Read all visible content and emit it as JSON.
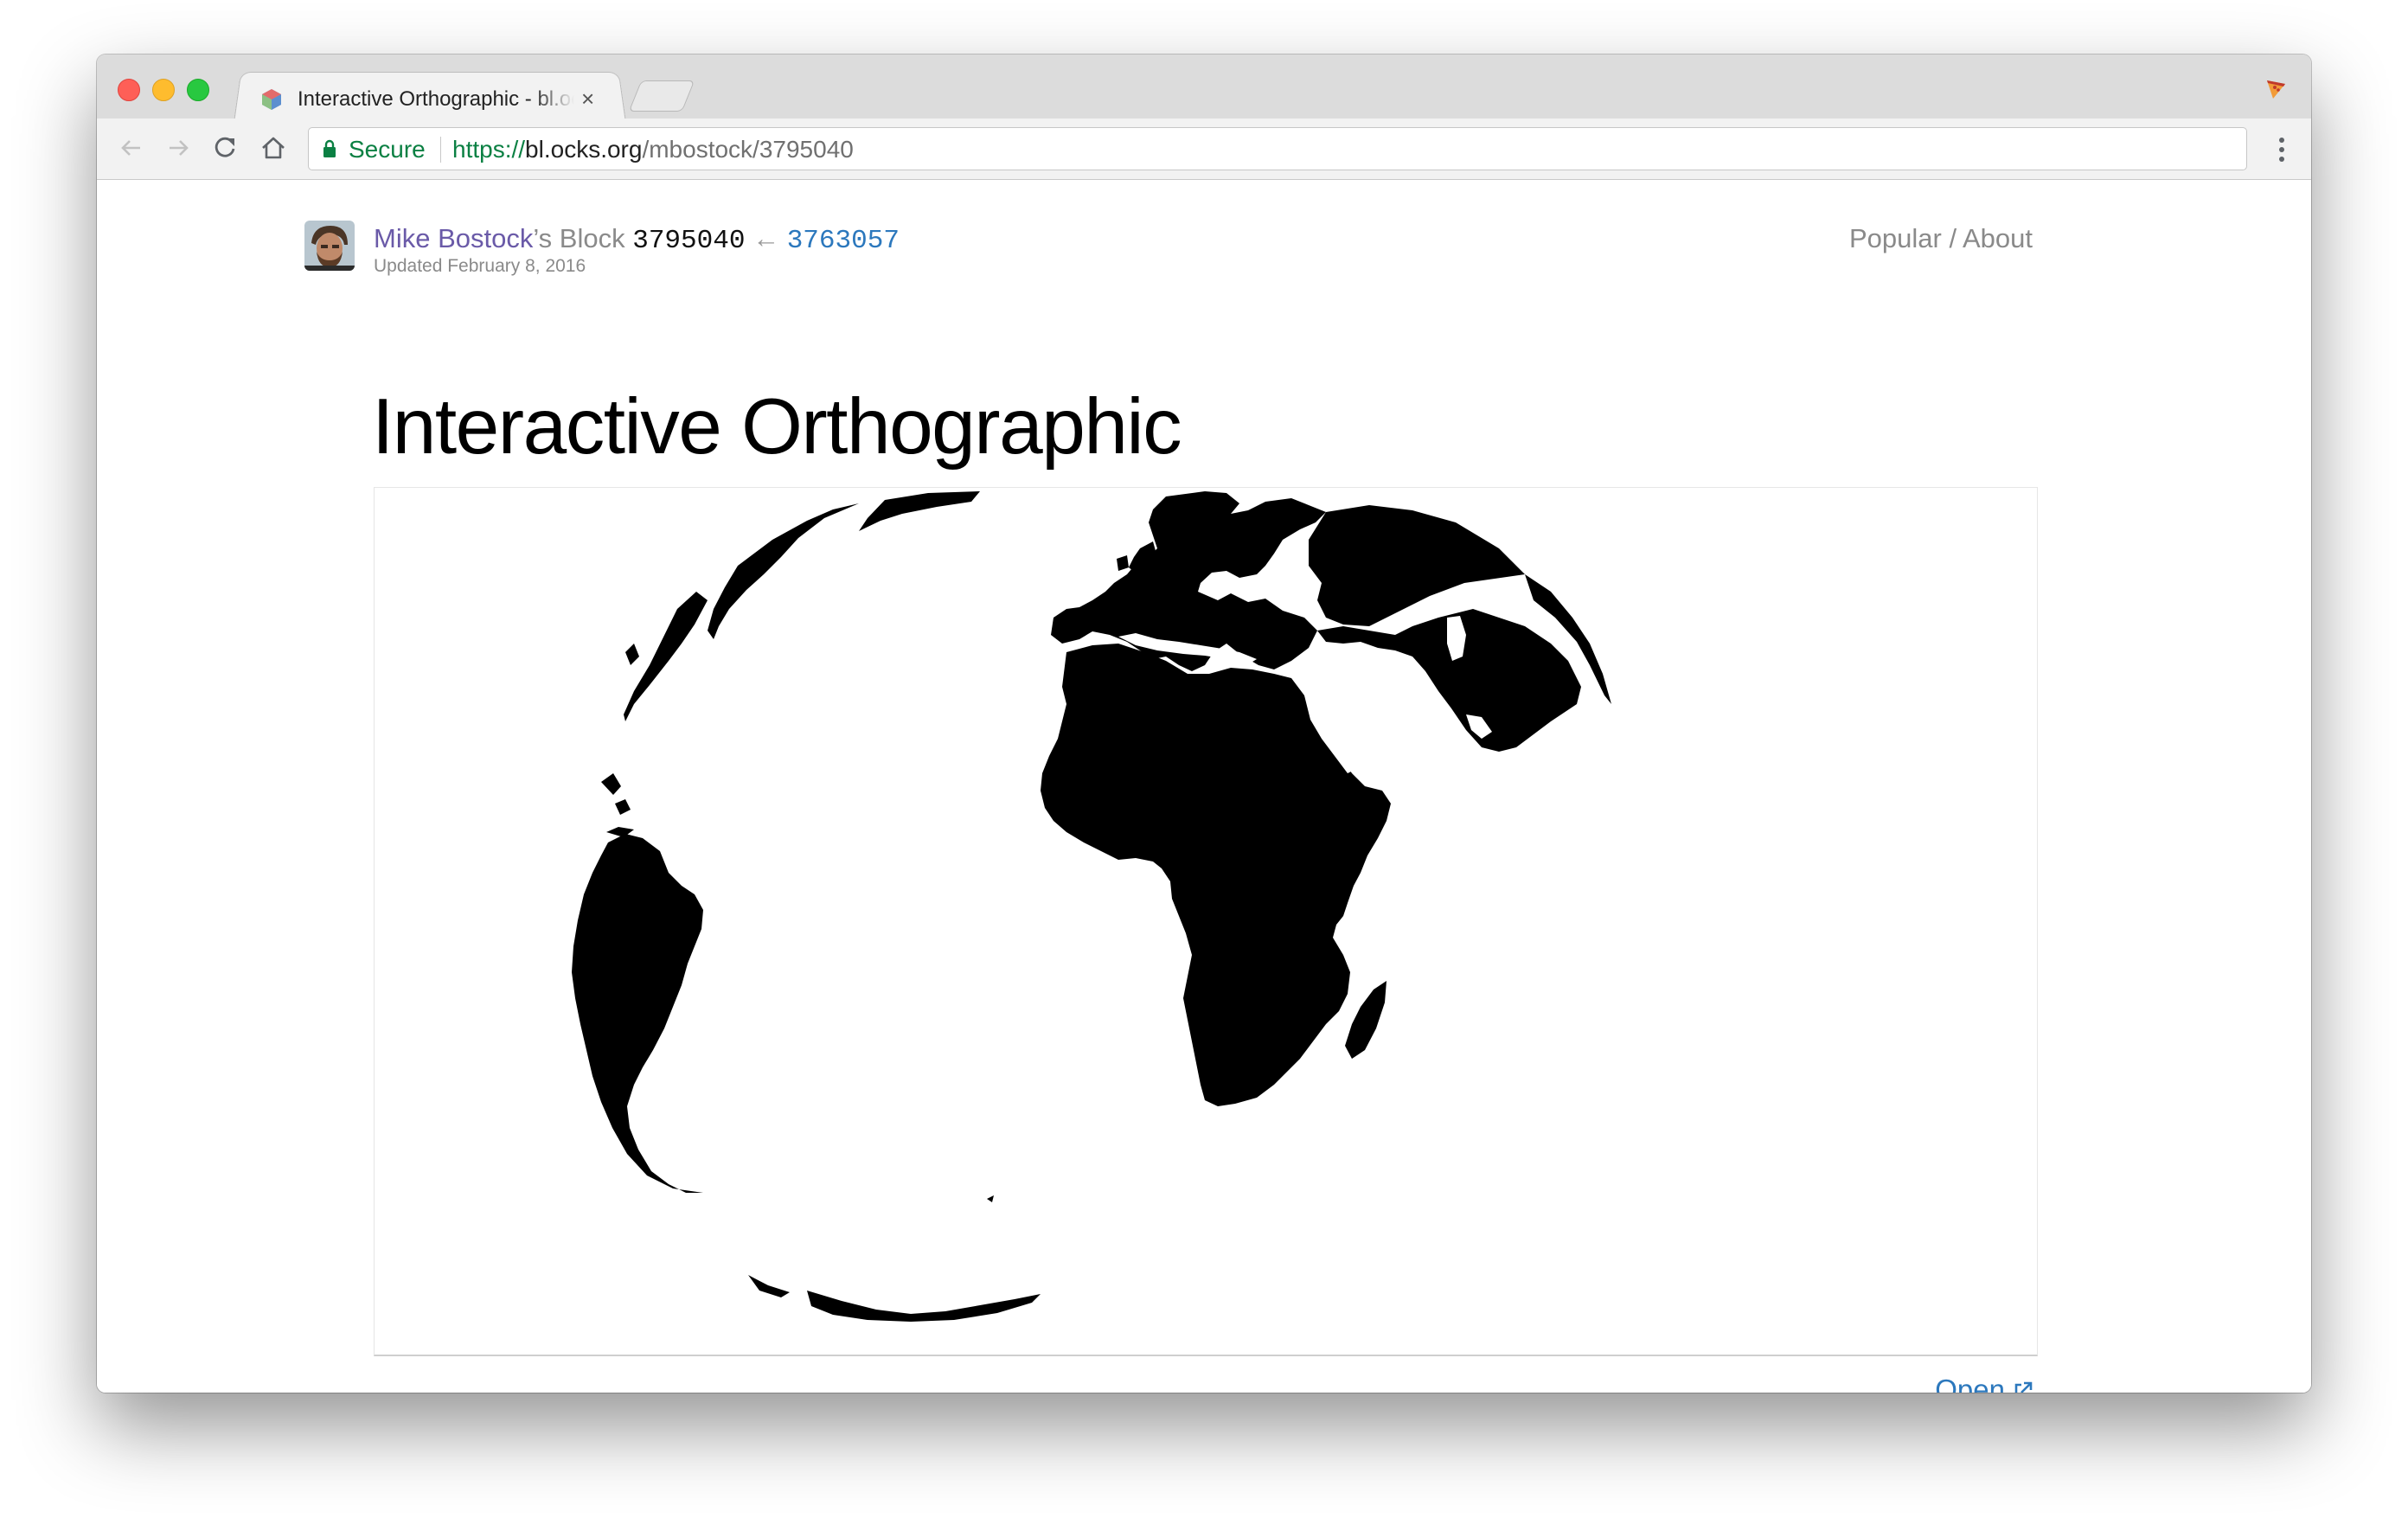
{
  "browser": {
    "tab_title": "Interactive Orthographic - bl.ocks.org",
    "tab_close": "×",
    "secure_label": "Secure",
    "url": {
      "scheme": "https://",
      "host": "bl.ocks.org",
      "path": "/mbostock/3795040"
    }
  },
  "header": {
    "author": "Mike Bostock",
    "possessive": "’s Block",
    "gist_id": "3795040",
    "arrow": "←",
    "parent_id": "3763057",
    "updated": "Updated February 8, 2016",
    "nav_popular": "Popular",
    "nav_separator": " / ",
    "nav_about": "About"
  },
  "main": {
    "title": "Interactive Orthographic",
    "open_label": "Open"
  },
  "colors": {
    "author_link": "#6a5aa8",
    "link": "#2c78bd",
    "secure_green": "#0b8043",
    "land": "#000000",
    "ocean": "#ffffff"
  },
  "icons": [
    "back-arrow-icon",
    "forward-arrow-icon",
    "reload-icon",
    "home-icon",
    "lock-icon",
    "menu-dots-icon",
    "external-link-icon",
    "favicon-icon",
    "extension-icon"
  ]
}
